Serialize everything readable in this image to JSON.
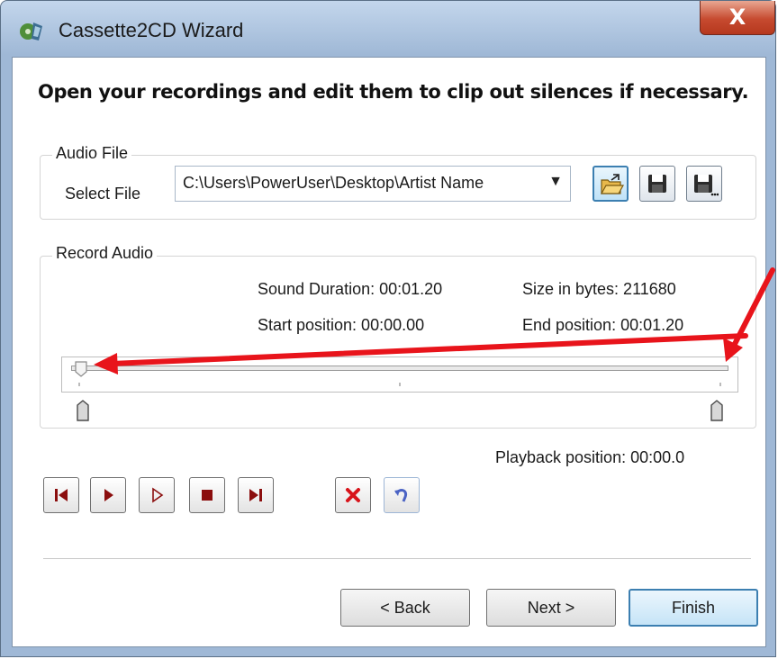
{
  "window": {
    "title": "Cassette2CD Wizard",
    "close_glyph": "X"
  },
  "heading": "Open your recordings and edit them to clip out silences if necessary.",
  "audio_file": {
    "group_label": "Audio File",
    "select_label": "Select File",
    "file_value": "C:\\Users\\PowerUser\\Desktop\\Artist Name",
    "open_icon": "open-folder-icon",
    "save_icon": "floppy-disk-icon",
    "save_as_icon": "floppy-disk-more-icon"
  },
  "record_audio": {
    "group_label": "Record Audio",
    "sound_duration": "Sound Duration: 00:01.20",
    "size_in_bytes": "Size in bytes: 211680",
    "start_position": "Start position: 00:00.00",
    "end_position": "End position: 00:01.20",
    "playback_position_fraction": 0
  },
  "playback_position": "Playback position: 00:00.0",
  "controls": [
    "go-to-start-icon",
    "play-icon",
    "play-selection-icon",
    "stop-icon",
    "go-to-end-icon",
    "delete-icon",
    "undo-icon"
  ],
  "buttons": {
    "back": "< Back",
    "next": "Next >",
    "finish": "Finish"
  },
  "colors": {
    "annotation_arrow": "#e8141b",
    "control_icon": "#8b0e0e",
    "accent_border": "#3c7fb1"
  }
}
